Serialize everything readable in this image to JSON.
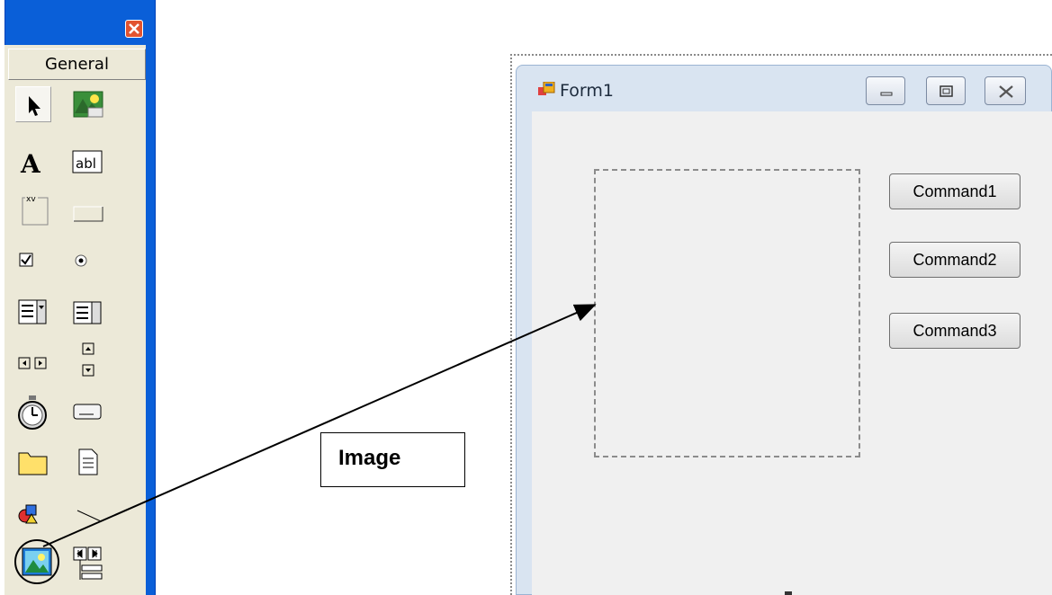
{
  "toolbox": {
    "tab_label": "General",
    "tools": [
      {
        "name": "pointer-icon"
      },
      {
        "name": "picturebox-icon"
      },
      {
        "name": "label-icon"
      },
      {
        "name": "textbox-icon"
      },
      {
        "name": "frame-icon"
      },
      {
        "name": "commandbutton-icon"
      },
      {
        "name": "checkbox-icon"
      },
      {
        "name": "optionbutton-icon"
      },
      {
        "name": "combobox-icon"
      },
      {
        "name": "listbox-icon"
      },
      {
        "name": "hscrollbar-icon"
      },
      {
        "name": "vscrollbar-icon"
      },
      {
        "name": "timer-icon"
      },
      {
        "name": "drivelistbox-icon"
      },
      {
        "name": "dirlistbox-icon"
      },
      {
        "name": "filelistbox-icon"
      },
      {
        "name": "shape-icon"
      },
      {
        "name": "line-icon"
      },
      {
        "name": "image-icon"
      },
      {
        "name": "data-icon"
      }
    ],
    "close_color": "#e2532f",
    "frame_color": "#0a5fd8"
  },
  "form": {
    "title": "Form1",
    "buttons": [
      "Command1",
      "Command2",
      "Command3"
    ]
  },
  "callout": {
    "label": "Image"
  }
}
